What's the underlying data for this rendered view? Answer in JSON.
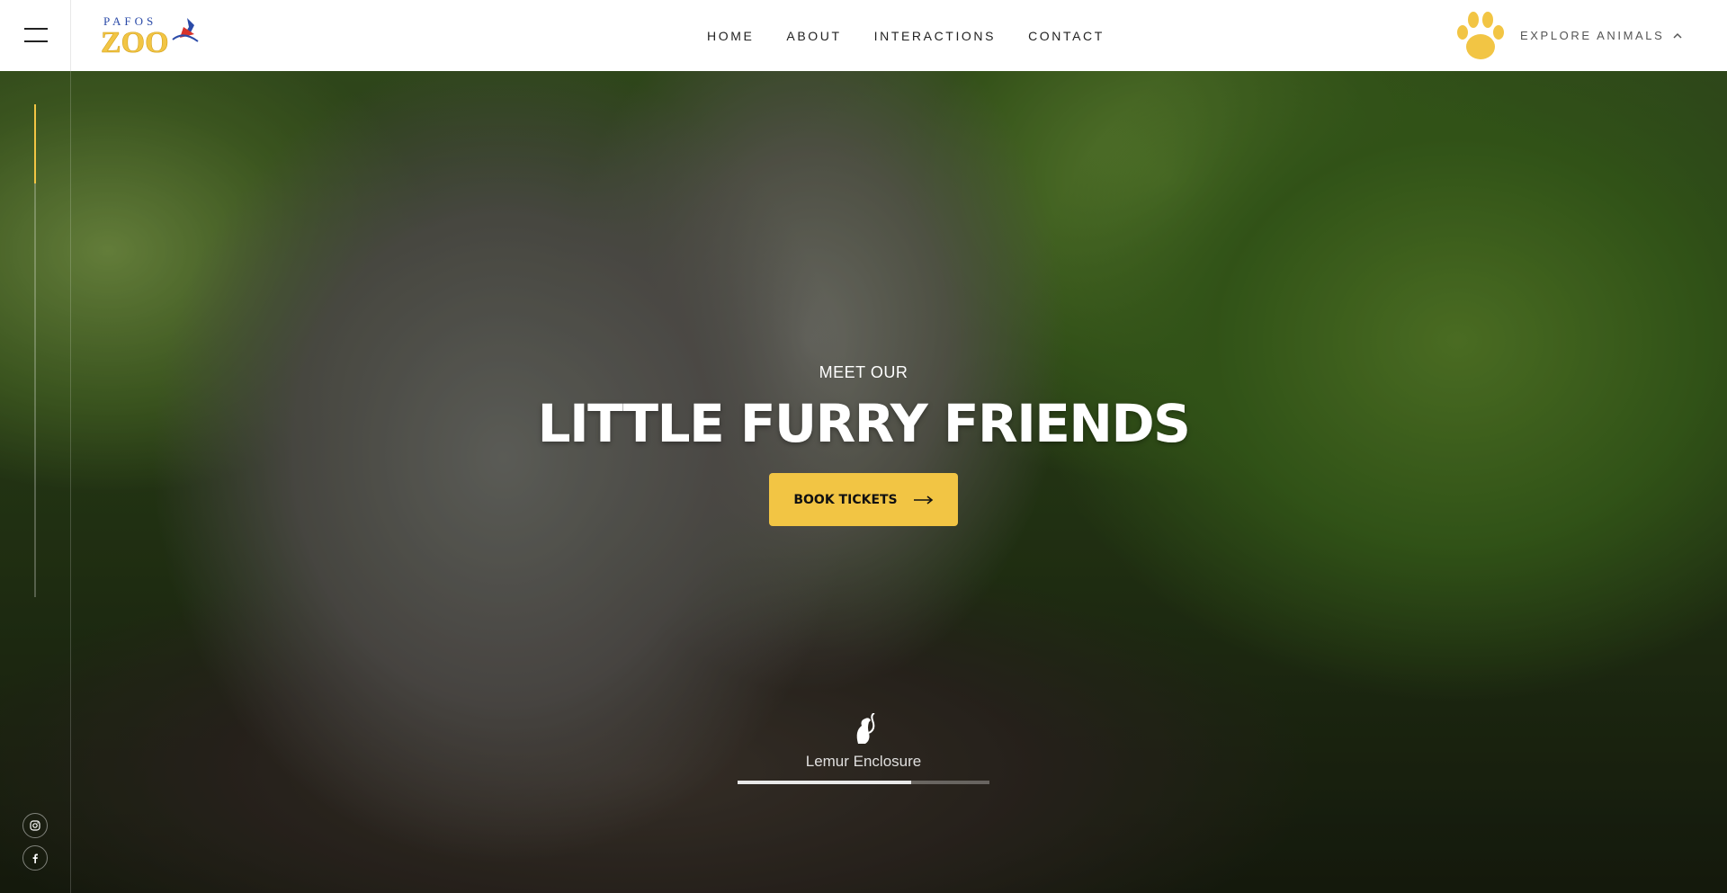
{
  "header": {
    "logo": {
      "top_text": "PAFOS",
      "main_text": "ZOO"
    },
    "nav": [
      "HOME",
      "ABOUT",
      "INTERACTIONS",
      "CONTACT"
    ],
    "explore_label": "EXPLORE ANIMALS",
    "icons": {
      "menu": "hamburger-icon",
      "paw": "paw-icon",
      "chevron": "chevron-up-icon"
    }
  },
  "hero": {
    "eyebrow": "MEET OUR",
    "headline": "LITTLE FURRY FRIENDS",
    "cta_label": "BOOK TICKETS",
    "enclosure_label": "Lemur Enclosure",
    "vertical_progress": 0.16,
    "slide_progress": 0.69
  },
  "social": [
    "instagram-icon",
    "facebook-icon"
  ],
  "colors": {
    "accent": "#f2c544",
    "header_bg": "#ffffff",
    "nav_text": "#222222"
  }
}
